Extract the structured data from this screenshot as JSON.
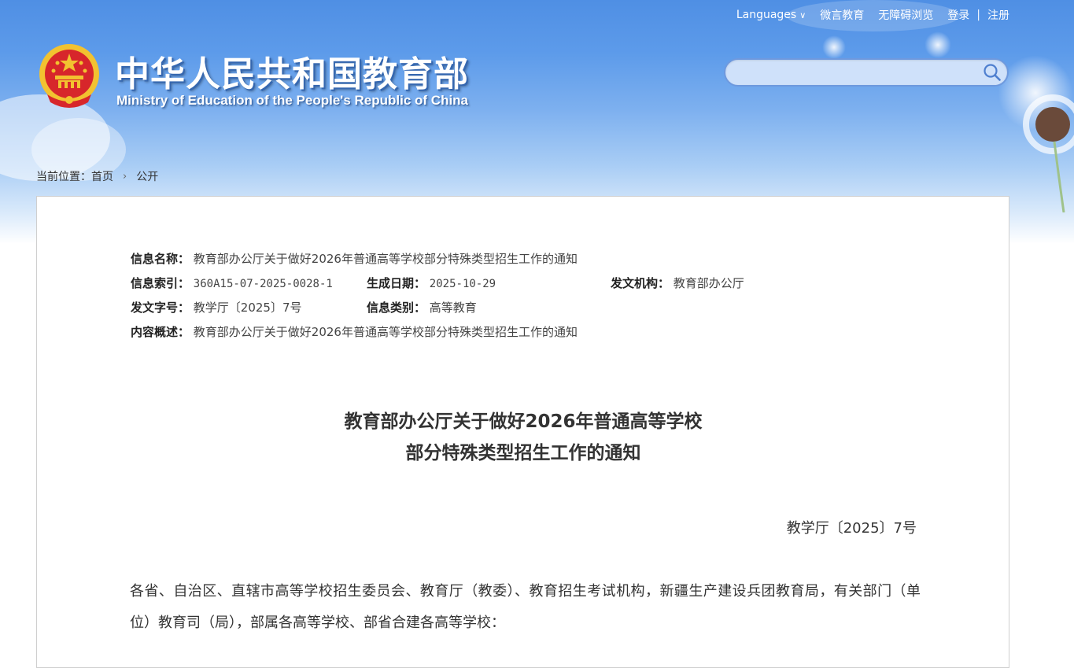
{
  "header": {
    "languages_label": "Languages",
    "links": [
      "微言教育",
      "无障碍浏览"
    ],
    "login": "登录",
    "separator": "|",
    "register": "注册",
    "site_title": "中华人民共和国教育部",
    "site_subtitle": "Ministry of Education of the People's Republic of China"
  },
  "search": {
    "placeholder": "",
    "value": ""
  },
  "breadcrumb": {
    "prefix": "当前位置：",
    "home": "首页",
    "current": "公开"
  },
  "meta": {
    "info_name_label": "信息名称：",
    "info_name": "教育部办公厅关于做好2026年普通高等学校部分特殊类型招生工作的通知",
    "index_label": "信息索引：",
    "index": "360A15-07-2025-0028-1",
    "date_label": "生成日期：",
    "date": "2025-10-29",
    "issuer_label": "发文机构：",
    "issuer": "教育部办公厅",
    "doc_no_label": "发文字号：",
    "doc_no": "教学厅〔2025〕7号",
    "category_label": "信息类别：",
    "category": "高等教育",
    "summary_label": "内容概述：",
    "summary": "教育部办公厅关于做好2026年普通高等学校部分特殊类型招生工作的通知"
  },
  "document": {
    "title_line1": "教育部办公厅关于做好2026年普通高等学校",
    "title_line2": "部分特殊类型招生工作的通知",
    "number": "教学厅〔2025〕7号",
    "salutation": "各省、自治区、直辖市高等学校招生委员会、教育厅（教委）、教育招生考试机构，新疆生产建设兵团教育局，有关部门（单位）教育司（局），部属各高等学校、部省合建各高等学校："
  },
  "colors": {
    "header_blue": "#4f8fe4",
    "title_shadow": "#3567b0",
    "emblem_red": "#d7262b",
    "emblem_gold": "#f2c230"
  }
}
